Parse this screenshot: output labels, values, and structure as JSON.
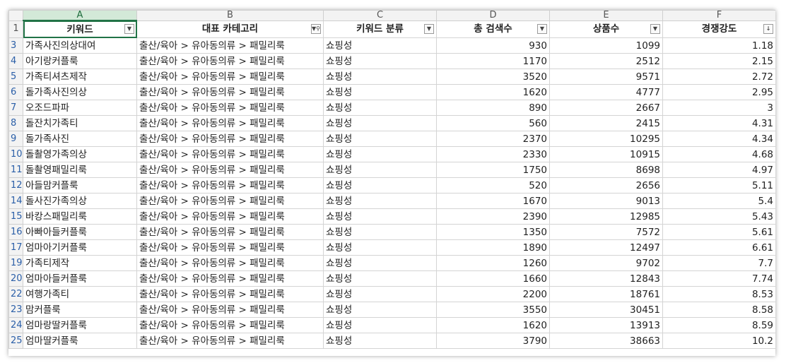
{
  "column_letters": [
    "A",
    "B",
    "C",
    "D",
    "E",
    "F"
  ],
  "header_row_number": "1",
  "headers": [
    {
      "label": "키워드",
      "filter": "dropdown"
    },
    {
      "label": "대표 카테고리",
      "filter": "filtered"
    },
    {
      "label": "키워드 분류",
      "filter": "dropdown"
    },
    {
      "label": "총 검색수",
      "filter": "dropdown"
    },
    {
      "label": "상품수",
      "filter": "dropdown"
    },
    {
      "label": "경쟁강도",
      "filter": "sorted"
    }
  ],
  "rows": [
    {
      "n": "3",
      "kw": "가족사진의상대여",
      "cat": "출산/육아 > 유아동의류 > 패밀리룩",
      "type": "쇼핑성",
      "search": "930",
      "products": "1099",
      "comp": "1.18"
    },
    {
      "n": "4",
      "kw": "아기랑커플룩",
      "cat": "출산/육아 > 유아동의류 > 패밀리룩",
      "type": "쇼핑성",
      "search": "1170",
      "products": "2512",
      "comp": "2.15"
    },
    {
      "n": "5",
      "kw": "가족티셔츠제작",
      "cat": "출산/육아 > 유아동의류 > 패밀리룩",
      "type": "쇼핑성",
      "search": "3520",
      "products": "9571",
      "comp": "2.72"
    },
    {
      "n": "6",
      "kw": "돌가족사진의상",
      "cat": "출산/육아 > 유아동의류 > 패밀리룩",
      "type": "쇼핑성",
      "search": "1620",
      "products": "4777",
      "comp": "2.95"
    },
    {
      "n": "7",
      "kw": "오조드파파",
      "cat": "출산/육아 > 유아동의류 > 패밀리룩",
      "type": "쇼핑성",
      "search": "890",
      "products": "2667",
      "comp": "3"
    },
    {
      "n": "8",
      "kw": "돌잔치가족티",
      "cat": "출산/육아 > 유아동의류 > 패밀리룩",
      "type": "쇼핑성",
      "search": "560",
      "products": "2415",
      "comp": "4.31"
    },
    {
      "n": "9",
      "kw": "돌가족사진",
      "cat": "출산/육아 > 유아동의류 > 패밀리룩",
      "type": "쇼핑성",
      "search": "2370",
      "products": "10295",
      "comp": "4.34"
    },
    {
      "n": "10",
      "kw": "돌촬영가족의상",
      "cat": "출산/육아 > 유아동의류 > 패밀리룩",
      "type": "쇼핑성",
      "search": "2330",
      "products": "10915",
      "comp": "4.68"
    },
    {
      "n": "11",
      "kw": "돌촬영패밀리룩",
      "cat": "출산/육아 > 유아동의류 > 패밀리룩",
      "type": "쇼핑성",
      "search": "1750",
      "products": "8698",
      "comp": "4.97"
    },
    {
      "n": "12",
      "kw": "아들맘커플룩",
      "cat": "출산/육아 > 유아동의류 > 패밀리룩",
      "type": "쇼핑성",
      "search": "520",
      "products": "2656",
      "comp": "5.11"
    },
    {
      "n": "14",
      "kw": "돌사진가족의상",
      "cat": "출산/육아 > 유아동의류 > 패밀리룩",
      "type": "쇼핑성",
      "search": "1670",
      "products": "9013",
      "comp": "5.4"
    },
    {
      "n": "15",
      "kw": "바캉스패밀리룩",
      "cat": "출산/육아 > 유아동의류 > 패밀리룩",
      "type": "쇼핑성",
      "search": "2390",
      "products": "12985",
      "comp": "5.43"
    },
    {
      "n": "16",
      "kw": "아빠아들커플룩",
      "cat": "출산/육아 > 유아동의류 > 패밀리룩",
      "type": "쇼핑성",
      "search": "1350",
      "products": "7572",
      "comp": "5.61"
    },
    {
      "n": "17",
      "kw": "엄마아기커플룩",
      "cat": "출산/육아 > 유아동의류 > 패밀리룩",
      "type": "쇼핑성",
      "search": "1890",
      "products": "12497",
      "comp": "6.61"
    },
    {
      "n": "19",
      "kw": "가족티제작",
      "cat": "출산/육아 > 유아동의류 > 패밀리룩",
      "type": "쇼핑성",
      "search": "1260",
      "products": "9702",
      "comp": "7.7"
    },
    {
      "n": "20",
      "kw": "엄마아들커플룩",
      "cat": "출산/육아 > 유아동의류 > 패밀리룩",
      "type": "쇼핑성",
      "search": "1660",
      "products": "12843",
      "comp": "7.74"
    },
    {
      "n": "22",
      "kw": "여행가족티",
      "cat": "출산/육아 > 유아동의류 > 패밀리룩",
      "type": "쇼핑성",
      "search": "2200",
      "products": "18761",
      "comp": "8.53"
    },
    {
      "n": "23",
      "kw": "맘커플룩",
      "cat": "출산/육아 > 유아동의류 > 패밀리룩",
      "type": "쇼핑성",
      "search": "3550",
      "products": "30451",
      "comp": "8.58"
    },
    {
      "n": "24",
      "kw": "엄마랑딸커플룩",
      "cat": "출산/육아 > 유아동의류 > 패밀리룩",
      "type": "쇼핑성",
      "search": "1620",
      "products": "13913",
      "comp": "8.59"
    },
    {
      "n": "25",
      "kw": "엄마딸커플룩",
      "cat": "출산/육아 > 유아동의류 > 패밀리룩",
      "type": "쇼핑성",
      "search": "3790",
      "products": "38663",
      "comp": "10.2"
    }
  ]
}
